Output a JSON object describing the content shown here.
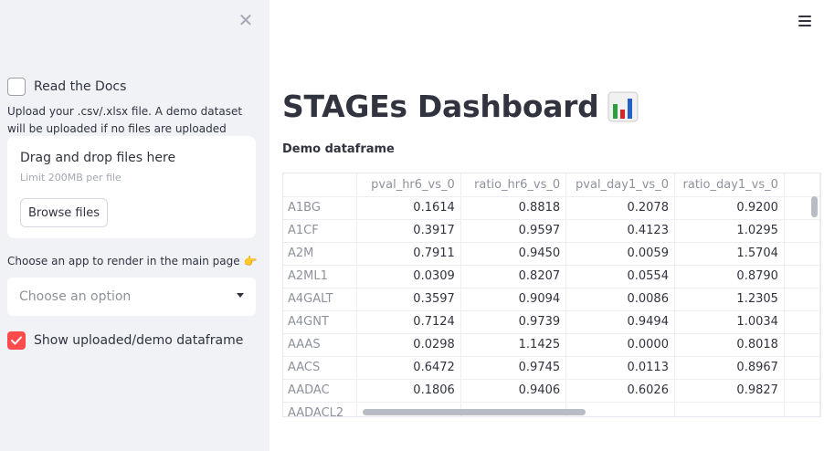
{
  "sidebar": {
    "close_icon": "close-icon",
    "read_docs": {
      "label": "Read the Docs",
      "checked": false
    },
    "upload_help": "Upload your .csv/.xlsx file. A demo dataset will be uploaded if no files are uploaded",
    "uploader": {
      "title": "Drag and drop files here",
      "limit": "Limit 200MB per file",
      "browse_label": "Browse files"
    },
    "choose_app_label": "Choose an app to render in the main page",
    "choose_app_icon": "pointing-hand-icon",
    "select": {
      "placeholder": "Choose an option"
    },
    "show_df": {
      "label": "Show uploaded/demo dataframe",
      "checked": true
    }
  },
  "header": {
    "menu_icon": "hamburger-menu-icon"
  },
  "main": {
    "title": "STAGEs Dashboard",
    "title_icon": "bar-chart-icon",
    "df_caption": "Demo dataframe",
    "table": {
      "columns": [
        "",
        "pval_hr6_vs_0",
        "ratio_hr6_vs_0",
        "pval_day1_vs_0",
        "ratio_day1_vs_0",
        ""
      ],
      "rows": [
        [
          "A1BG",
          "0.1614",
          "0.8818",
          "0.2078",
          "0.9200"
        ],
        [
          "A1CF",
          "0.3917",
          "0.9597",
          "0.4123",
          "1.0295"
        ],
        [
          "A2M",
          "0.7911",
          "0.9450",
          "0.0059",
          "1.5704"
        ],
        [
          "A2ML1",
          "0.0309",
          "0.8207",
          "0.0554",
          "0.8790"
        ],
        [
          "A4GALT",
          "0.3597",
          "0.9094",
          "0.0086",
          "1.2305"
        ],
        [
          "A4GNT",
          "0.7124",
          "0.9739",
          "0.9494",
          "1.0034"
        ],
        [
          "AAAS",
          "0.0298",
          "1.1425",
          "0.0000",
          "0.8018"
        ],
        [
          "AACS",
          "0.6472",
          "0.9745",
          "0.0113",
          "0.8967"
        ],
        [
          "AADAC",
          "0.1806",
          "0.9406",
          "0.6026",
          "0.9827"
        ],
        [
          "AADACL2",
          "",
          "",
          "",
          ""
        ]
      ]
    }
  },
  "colors": {
    "accent": "#ff4b4b",
    "sidebar_bg": "#f0f2f6",
    "text": "#31333f",
    "muted": "#8e929c"
  }
}
